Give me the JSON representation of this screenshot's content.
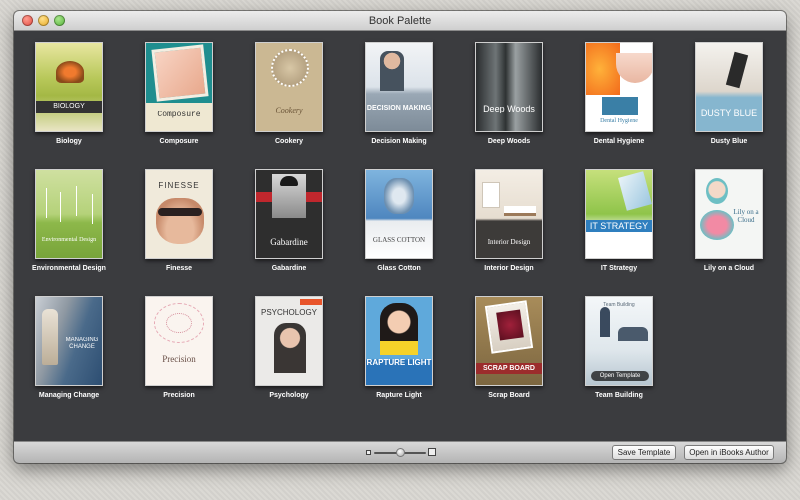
{
  "window": {
    "title": "Book Palette"
  },
  "templates": [
    {
      "label": "Biology",
      "cover_title": "BIOLOGY"
    },
    {
      "label": "Composure",
      "cover_title": "Composure"
    },
    {
      "label": "Cookery",
      "cover_title": "Cookery"
    },
    {
      "label": "Decision Making",
      "cover_title": "DECISION MAKING"
    },
    {
      "label": "Deep Woods",
      "cover_title": "Deep Woods"
    },
    {
      "label": "Dental Hygiene",
      "cover_title": "Dental Hygiene"
    },
    {
      "label": "Dusty Blue",
      "cover_title": "DUSTY BLUE"
    },
    {
      "label": "Environmental Design",
      "cover_title": "Environmental Design"
    },
    {
      "label": "Finesse",
      "cover_title": "FINESSE"
    },
    {
      "label": "Gabardine",
      "cover_title": "Gabardine"
    },
    {
      "label": "Glass Cotton",
      "cover_title": "GLASS COTTON"
    },
    {
      "label": "Interior Design",
      "cover_title": "Interior Design"
    },
    {
      "label": "IT Strategy",
      "cover_title": "IT STRATEGY"
    },
    {
      "label": "Lily on a Cloud",
      "cover_title": "Lily on a Cloud"
    },
    {
      "label": "Managing Change",
      "cover_title": "MANAGING CHANGE"
    },
    {
      "label": "Precision",
      "cover_title": "Precision"
    },
    {
      "label": "Psychology",
      "cover_title": "PSYCHOLOGY"
    },
    {
      "label": "Rapture Light",
      "cover_title": "RAPTURE LIGHT"
    },
    {
      "label": "Scrap Board",
      "cover_title": "SCRAP BOARD"
    },
    {
      "label": "Team Building",
      "cover_title": "Team Building"
    }
  ],
  "hover_overlay": {
    "label": "Open Template"
  },
  "bottom_bar": {
    "save_label": "Save Template",
    "open_label": "Open in iBooks Author"
  },
  "icons": [
    "zoom-small-icon",
    "zoom-large-icon"
  ]
}
